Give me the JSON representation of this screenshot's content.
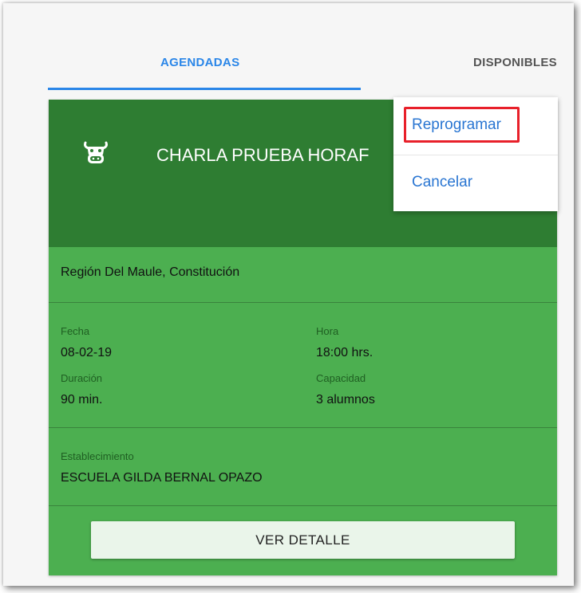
{
  "tabs": {
    "agendadas": "AGENDADAS",
    "disponibles": "DISPONIBLES"
  },
  "card": {
    "icon": "cow-icon",
    "title": "CHARLA PRUEBA HORAF",
    "location": "Región Del Maule, Constitución",
    "fecha_label": "Fecha",
    "fecha_value": "08-02-19",
    "hora_label": "Hora",
    "hora_value": "18:00 hrs.",
    "duracion_label": "Duración",
    "duracion_value": "90 min.",
    "capacidad_label": "Capacidad",
    "capacidad_value": "3 alumnos",
    "establecimiento_label": "Establecimiento",
    "establecimiento_value": "ESCUELA GILDA BERNAL OPAZO",
    "detail_button": "VER DETALLE"
  },
  "menu": {
    "reprogramar": "Reprogramar",
    "cancelar": "Cancelar"
  },
  "colors": {
    "accent_blue": "#2a86e8",
    "header_green": "#2e7d32",
    "card_green": "#4caf50",
    "highlight_red": "#e8202a"
  }
}
